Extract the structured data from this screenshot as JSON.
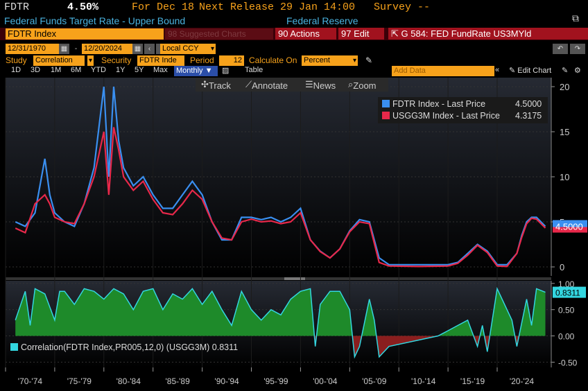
{
  "header": {
    "ticker": "FDTR",
    "value": "4.50%",
    "for_label": "For Dec 18",
    "next_release": "Next Release 29 Jan 14:00",
    "survey": "Survey --",
    "description": "Federal Funds Target Rate - Upper Bound",
    "source": "Federal Reserve"
  },
  "toolbar1": {
    "security": "FDTR Index",
    "suggested": "98 Suggested Charts",
    "actions": "90 Actions",
    "edit": "97 Edit",
    "chart_title": "G 584: FED FundRate US3MYld"
  },
  "dates": {
    "start": "12/31/1970",
    "end": "12/20/2024",
    "currency": "Local CCY"
  },
  "study_row": {
    "study_label": "Study",
    "study_value": "Correlation",
    "security_label": "Security",
    "security_value": "FDTR Inde",
    "period_label": "Period",
    "period_value": "12",
    "calc_label": "Calculate On",
    "calc_value": "Percent"
  },
  "range_row": {
    "ranges": [
      "1D",
      "3D",
      "1M",
      "6M",
      "YTD",
      "1Y",
      "5Y",
      "Max"
    ],
    "frequency": "Monthly",
    "table": "Table",
    "add_data": "Add Data",
    "edit_chart": "Edit Chart"
  },
  "chart_toolbar": {
    "track": "Track",
    "annotate": "Annotate",
    "news": "News",
    "zoom": "Zoom"
  },
  "colors": {
    "fdtr": "#3a8ff0",
    "usgg": "#e8284a",
    "corr_fill": "#1e8a2a",
    "corr_neg": "#8a1e1e",
    "accent": "#f7a21b"
  },
  "chart_data": [
    {
      "type": "line",
      "series": [
        {
          "name": "FDTR Index - Last Price",
          "last": "4.5000",
          "x": [
            1971,
            1972,
            1973,
            1974,
            1974.5,
            1975,
            1976,
            1977,
            1978,
            1979,
            1980,
            1980.5,
            1981,
            1981.5,
            1982,
            1983,
            1984,
            1985,
            1986,
            1987,
            1988,
            1989,
            1990,
            1991,
            1992,
            1993,
            1994,
            1995,
            1996,
            1997,
            1998,
            1999,
            2000,
            2001,
            2002,
            2003,
            2004,
            2005,
            2006,
            2007,
            2008,
            2009,
            2012,
            2015,
            2016,
            2017,
            2018,
            2019,
            2020,
            2021,
            2022,
            2022.5,
            2023,
            2023.5,
            2024,
            2024.9
          ],
          "values": [
            5,
            4.5,
            6,
            12,
            8,
            6,
            5,
            4.5,
            7,
            11,
            20,
            10,
            20,
            14,
            11,
            9,
            10,
            8,
            6.5,
            6.5,
            8,
            9.5,
            8,
            5,
            3,
            3,
            5.5,
            5.5,
            5.25,
            5.5,
            5,
            5.5,
            6.5,
            3,
            1.75,
            1,
            2,
            4,
            5.25,
            5,
            1,
            0.25,
            0.25,
            0.25,
            0.5,
            1.5,
            2.5,
            1.75,
            0.25,
            0.25,
            1.5,
            3.5,
            5,
            5.5,
            5.5,
            4.5
          ]
        },
        {
          "name": "USGG3M Index - Last Price",
          "last": "4.3175",
          "x": [
            1971,
            1972,
            1973,
            1974,
            1974.5,
            1975,
            1976,
            1977,
            1978,
            1979,
            1980,
            1980.5,
            1981,
            1981.5,
            1982,
            1983,
            1984,
            1985,
            1986,
            1987,
            1988,
            1989,
            1990,
            1991,
            1992,
            1993,
            1994,
            1995,
            1996,
            1997,
            1998,
            1999,
            2000,
            2001,
            2002,
            2003,
            2004,
            2005,
            2006,
            2007,
            2008,
            2009,
            2012,
            2015,
            2016,
            2017,
            2018,
            2019,
            2020,
            2021,
            2022,
            2022.5,
            2023,
            2023.5,
            2024,
            2024.9
          ],
          "values": [
            4.3,
            3.8,
            7,
            8,
            7,
            5.5,
            5,
            4.8,
            7,
            10,
            15,
            8,
            15.5,
            13,
            10,
            8.5,
            9.5,
            7.5,
            6,
            5.8,
            7,
            8.5,
            7.5,
            5,
            3.2,
            3,
            5,
            5.3,
            5,
            5.1,
            4.8,
            5,
            6,
            3,
            1.7,
            1,
            2,
            3.9,
            5,
            4.8,
            0.5,
            0.1,
            0.05,
            0.1,
            0.4,
            1.3,
            2.4,
            1.6,
            0.1,
            0.05,
            1.5,
            3.3,
            4.8,
            5.4,
            5.3,
            4.3175
          ]
        }
      ],
      "x_ticks": [
        "'70-'74",
        "'75-'79",
        "'80-'84",
        "'85-'89",
        "'90-'94",
        "'95-'99",
        "'00-'04",
        "'05-'09",
        "'10-'14",
        "'15-'19",
        "'20-'24"
      ],
      "y_ticks": [
        "0",
        "5",
        "10",
        "15",
        "20"
      ],
      "ylim": [
        -1,
        21
      ],
      "xlim": [
        1970,
        2025.5
      ],
      "legend": "top-right",
      "last_label": "4.5000"
    },
    {
      "type": "area",
      "series": [
        {
          "name": "Correlation(FDTR Index,PR005,12,0) (USGG3M)",
          "last": "0.8311",
          "x": [
            1971,
            1972,
            1972.5,
            1973,
            1974,
            1975,
            1975.5,
            1976,
            1977,
            1978,
            1979,
            1980,
            1981,
            1982,
            1983,
            1984,
            1985,
            1986,
            1987,
            1988,
            1989,
            1990,
            1991,
            1992,
            1993,
            1994,
            1995,
            1996,
            1997,
            1998,
            1999,
            2000,
            2001,
            2001.5,
            2002,
            2003,
            2004,
            2005,
            2005.5,
            2006,
            2007,
            2007.5,
            2008,
            2009,
            2014,
            2015,
            2016,
            2017,
            2018,
            2018.5,
            2019,
            2020,
            2021,
            2021.5,
            2022,
            2023,
            2023.5,
            2024,
            2024.9
          ],
          "values": [
            0.3,
            0.85,
            0.2,
            0.9,
            0.8,
            0.3,
            0.85,
            0.85,
            0.6,
            0.9,
            0.85,
            0.7,
            0.9,
            0.8,
            0.5,
            0.85,
            0.9,
            0.5,
            0.8,
            0.7,
            0.9,
            0.6,
            0.85,
            0.5,
            0.2,
            0.85,
            0.5,
            0.3,
            0.5,
            0.4,
            0.7,
            0.85,
            0.9,
            -0.2,
            0.6,
            0.85,
            0.85,
            0.5,
            -0.4,
            -0.2,
            0.7,
            0.3,
            -0.4,
            -0.2,
            0,
            0.1,
            0.2,
            0.3,
            -0.2,
            0.2,
            -0.3,
            0.9,
            0.5,
            0.3,
            -0.2,
            0.7,
            0.2,
            0.9,
            0.8311
          ]
        }
      ],
      "y_ticks": [
        "-0.50",
        "0.00",
        "0.50",
        "1.00"
      ],
      "ylim": [
        -0.6,
        1.05
      ],
      "last_label": "0.8311"
    }
  ]
}
